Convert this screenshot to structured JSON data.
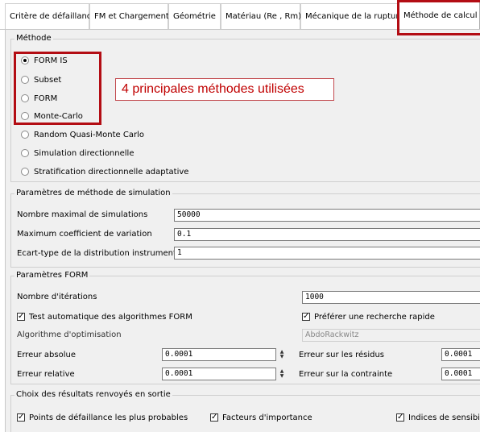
{
  "tabs": [
    {
      "label": "Critère de défaillance"
    },
    {
      "label": "FM et Chargement"
    },
    {
      "label": "Géométrie"
    },
    {
      "label": "Matériau (Re , Rm)"
    },
    {
      "label": "Mécanique de la rupture"
    },
    {
      "label": "Méthode de calcul",
      "active": true
    }
  ],
  "methode": {
    "legend": "Méthode",
    "options": [
      {
        "label": "FORM IS",
        "selected": true
      },
      {
        "label": "Subset",
        "selected": false
      },
      {
        "label": "FORM",
        "selected": false
      },
      {
        "label": "Monte-Carlo",
        "selected": false
      },
      {
        "label": "Random Quasi-Monte Carlo",
        "selected": false
      },
      {
        "label": "Simulation directionnelle",
        "selected": false
      },
      {
        "label": "Stratification directionnelle adaptative",
        "selected": false
      }
    ]
  },
  "annotation": {
    "text": "4 principales méthodes utilisées",
    "color": "#c00000"
  },
  "simulation": {
    "legend": "Paramètres de méthode de simulation",
    "max_sims_label": "Nombre maximal de simulations",
    "max_sims_value": "50000",
    "max_cv_label": "Maximum coefficient de variation",
    "max_cv_value": "0.1",
    "std_label": "Ecart-type de la distribution instrumentale",
    "std_value": "1"
  },
  "form": {
    "legend": "Paramètres FORM",
    "iterations_label": "Nombre d'itérations",
    "iterations_value": "1000",
    "auto_test_label": "Test automatique des algorithmes FORM",
    "auto_test_checked": true,
    "fast_search_label": "Préférer une recherche rapide",
    "fast_search_checked": true,
    "algo_label": "Algorithme d'optimisation",
    "algo_value": "AbdoRackwitz",
    "abs_err_label": "Erreur absolue",
    "abs_err_value": "0.0001",
    "residual_err_label": "Erreur sur les résidus",
    "residual_err_value": "0.0001",
    "rel_err_label": "Erreur relative",
    "rel_err_value": "0.0001",
    "constraint_err_label": "Erreur sur la contrainte",
    "constraint_err_value": "0.0001"
  },
  "results": {
    "legend": "Choix des résultats renvoyés en sortie",
    "points_label": "Points de défaillance les plus probables",
    "importance_label": "Facteurs d'importance",
    "sensitivity_label": "Indices de sensibilité"
  },
  "icons": {
    "radio": "radio-button",
    "check": "checkmark",
    "spin": "spin-arrows"
  },
  "colors": {
    "highlight": "#b30d14",
    "panel": "#f0f0f0"
  }
}
